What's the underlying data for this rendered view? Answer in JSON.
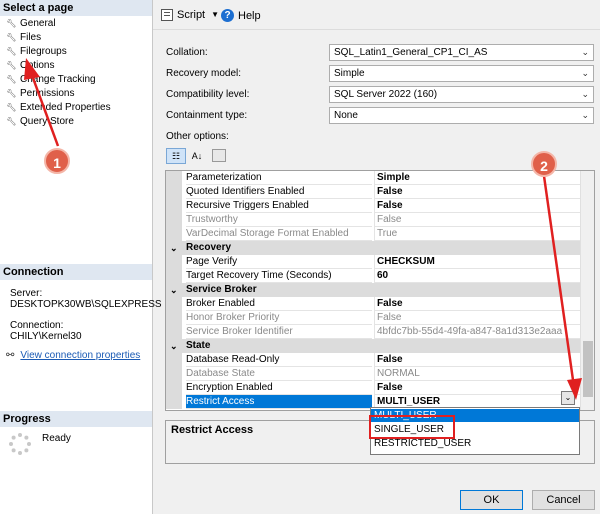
{
  "left": {
    "select_page_header": "Select a page",
    "pages": [
      "General",
      "Files",
      "Filegroups",
      "Options",
      "Change Tracking",
      "Permissions",
      "Extended Properties",
      "Query Store"
    ],
    "connection_header": "Connection",
    "server_label": "Server:",
    "server_value": "DESKTOPK30WB\\SQLEXPRESS",
    "connection_label": "Connection:",
    "connection_value": "CHILY\\Kernel30",
    "view_link": "View connection properties",
    "progress_header": "Progress",
    "progress_status": "Ready"
  },
  "toolbar": {
    "script_label": "Script",
    "help_label": "Help"
  },
  "props": {
    "collation_label": "Collation:",
    "collation_value": "SQL_Latin1_General_CP1_CI_AS",
    "recovery_label": "Recovery model:",
    "recovery_value": "Simple",
    "compat_label": "Compatibility level:",
    "compat_value": "SQL Server 2022 (160)",
    "containment_label": "Containment type:",
    "containment_value": "None",
    "other_options_label": "Other options:"
  },
  "grid_rows": [
    {
      "name": "Parameterization",
      "value": "Simple",
      "style": "bold"
    },
    {
      "name": "Quoted Identifiers Enabled",
      "value": "False",
      "style": "bold"
    },
    {
      "name": "Recursive Triggers Enabled",
      "value": "False",
      "style": "bold"
    },
    {
      "name": "Trustworthy",
      "value": "False",
      "style": "gray"
    },
    {
      "name": "VarDecimal Storage Format Enabled",
      "value": "True",
      "style": "gray"
    },
    {
      "category": "Recovery"
    },
    {
      "name": "Page Verify",
      "value": "CHECKSUM",
      "style": "bold"
    },
    {
      "name": "Target Recovery Time (Seconds)",
      "value": "60",
      "style": "bold"
    },
    {
      "category": "Service Broker"
    },
    {
      "name": "Broker Enabled",
      "value": "False",
      "style": "bold"
    },
    {
      "name": "Honor Broker Priority",
      "value": "False",
      "style": "gray"
    },
    {
      "name": "Service Broker Identifier",
      "value": "4bfdc7bb-55d4-49fa-a847-8a1d313e2aaa",
      "style": "gray"
    },
    {
      "category": "State"
    },
    {
      "name": "Database Read-Only",
      "value": "False",
      "style": "bold"
    },
    {
      "name": "Database State",
      "value": "NORMAL",
      "style": "gray"
    },
    {
      "name": "Encryption Enabled",
      "value": "False",
      "style": "bold"
    },
    {
      "name": "Restrict Access",
      "value": "MULTI_USER",
      "style": "selected"
    }
  ],
  "dropdown_options": [
    "MULTI_USER",
    "SINGLE_USER",
    "RESTRICTED_USER"
  ],
  "description_title": "Restrict Access",
  "buttons": {
    "ok": "OK",
    "cancel": "Cancel"
  },
  "callouts": {
    "one": "1",
    "two": "2"
  },
  "colors": {
    "selection": "#0078d7",
    "annotation": "#e02020",
    "callout": "#e0604a"
  }
}
